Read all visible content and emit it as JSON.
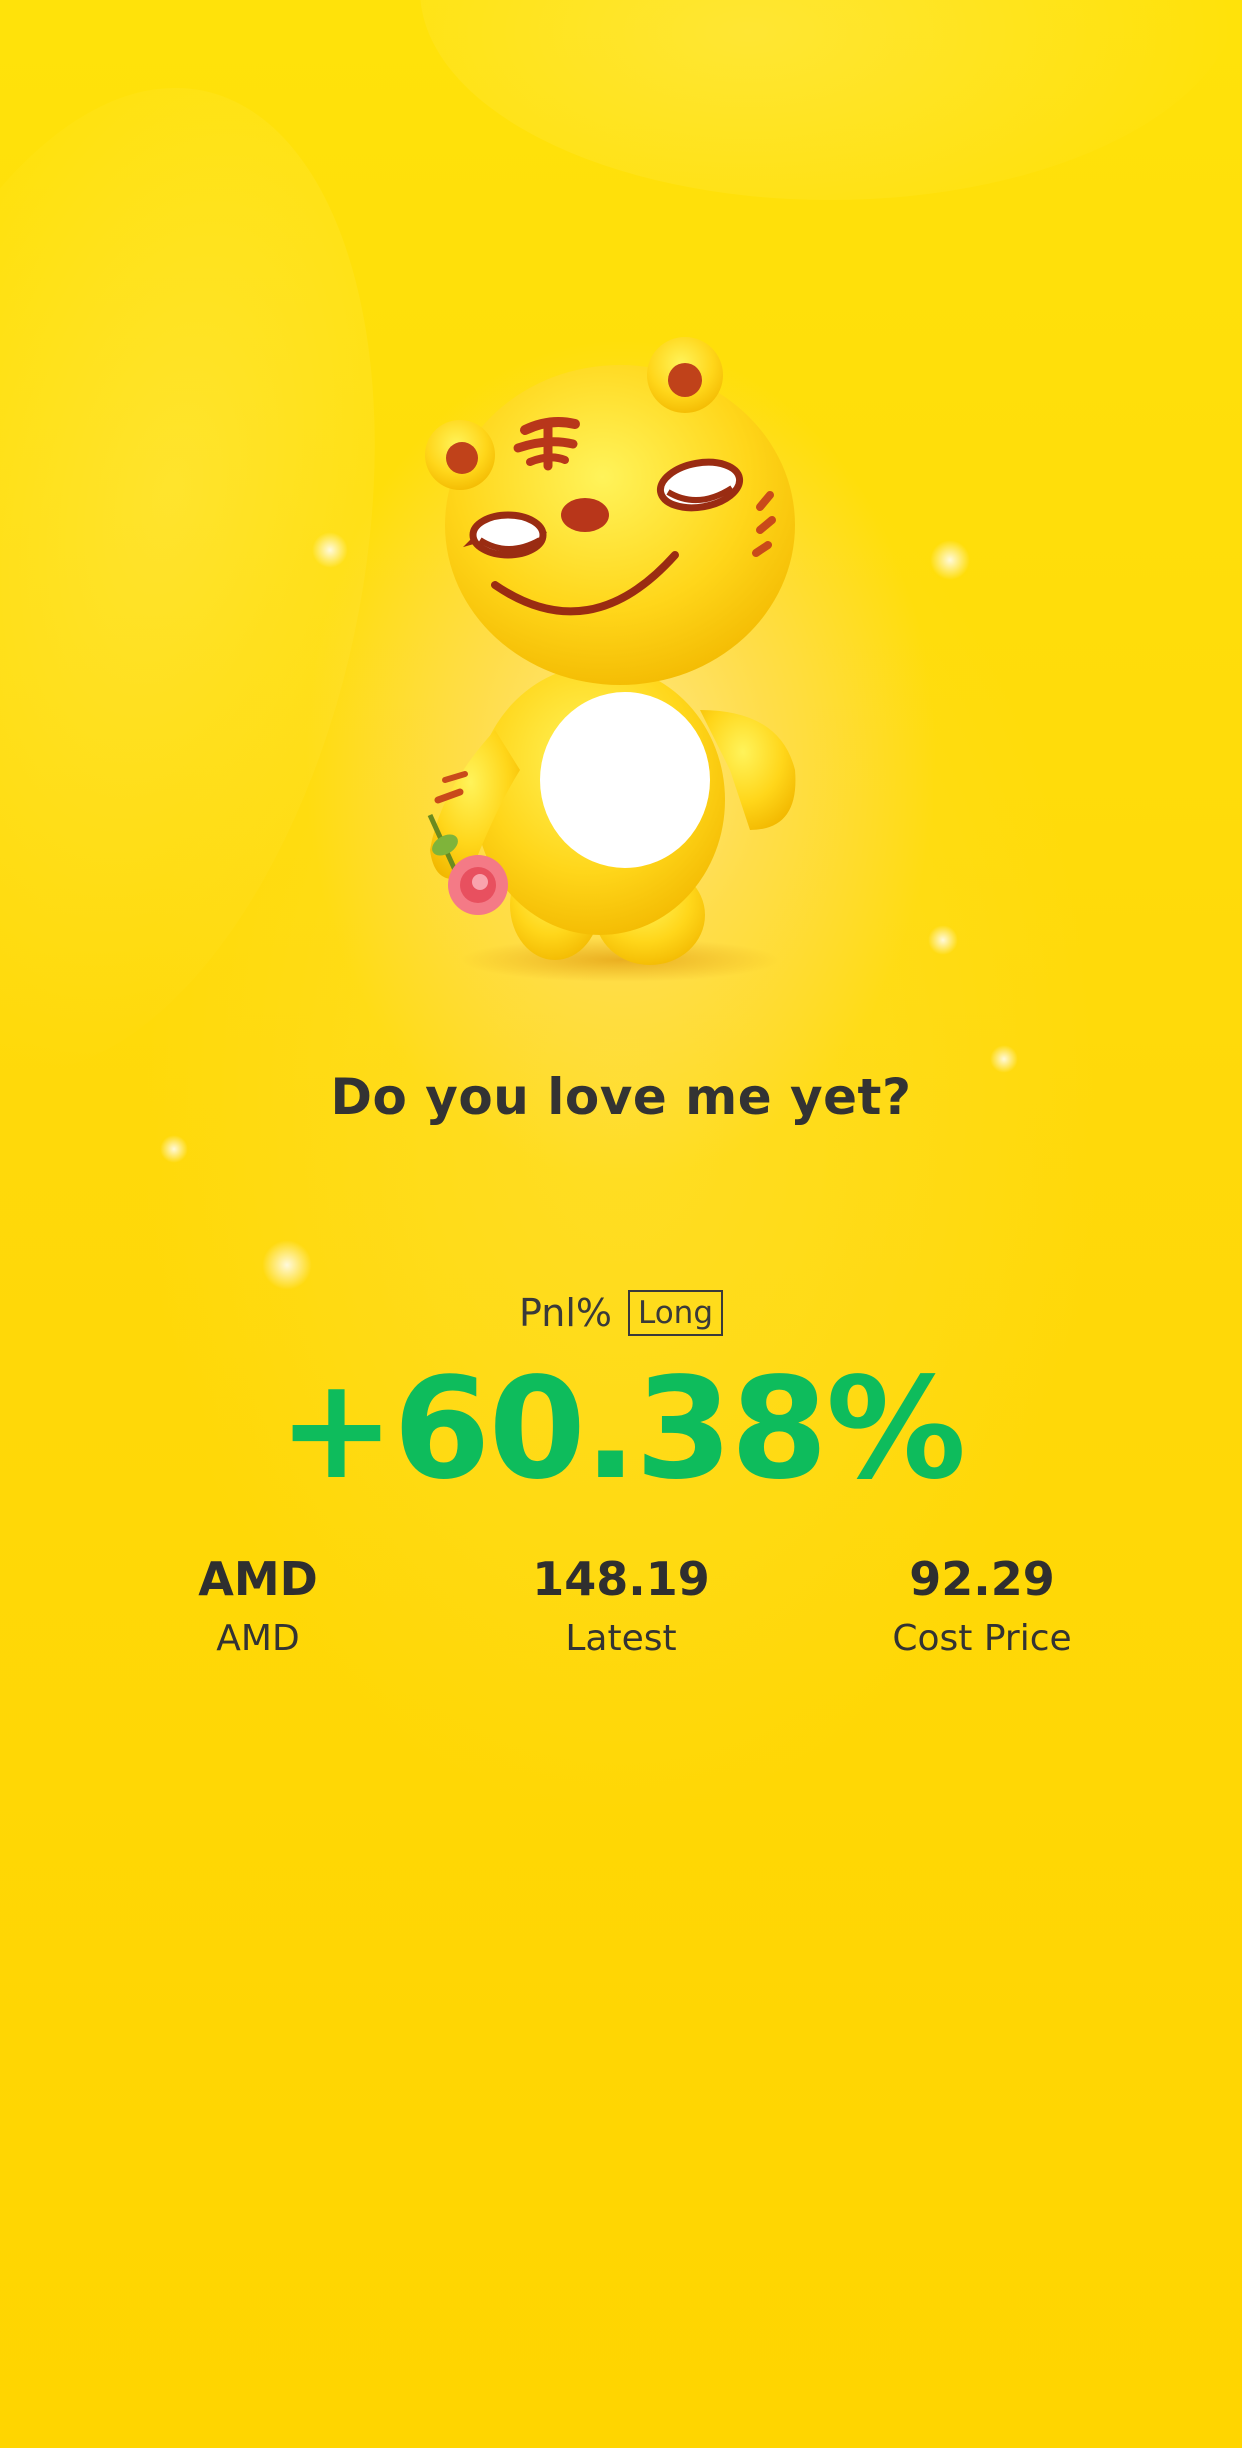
{
  "tagline": "Do you love me yet?",
  "pnl": {
    "label": "Pnl%",
    "direction_badge": "Long",
    "value": "+60.38%",
    "value_color": "#0ebc5c"
  },
  "stats": [
    {
      "value": "AMD",
      "label": "AMD"
    },
    {
      "value": "148.19",
      "label": "Latest"
    },
    {
      "value": "92.29",
      "label": "Cost Price"
    }
  ],
  "mascot_icon": "tiger-mascot-icon",
  "colors": {
    "background": "#ffd90a",
    "profit_green": "#0ebc5c",
    "text_dark": "#333333"
  }
}
